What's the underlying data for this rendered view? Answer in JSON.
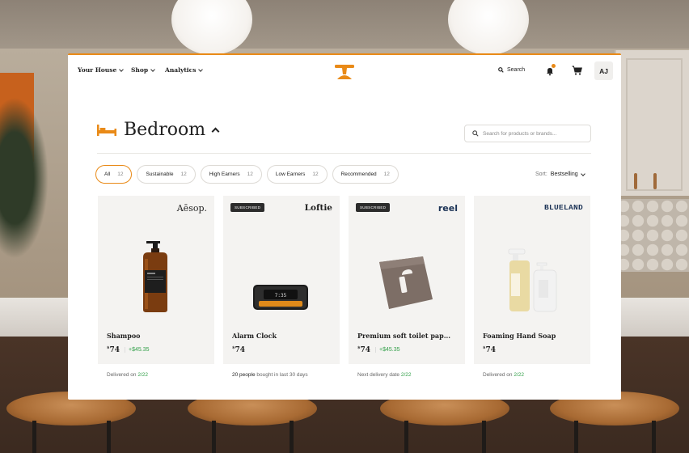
{
  "nav": {
    "items": [
      {
        "label": "Your House"
      },
      {
        "label": "Shop"
      },
      {
        "label": "Analytics"
      }
    ],
    "search_label": "Search",
    "avatar_initials": "AJ",
    "accent_color": "#e98a17"
  },
  "page": {
    "title": "Bedroom",
    "search_placeholder": "Search for products or brands..."
  },
  "filters": [
    {
      "label": "All",
      "count": "12",
      "active": true
    },
    {
      "label": "Sustainable",
      "count": "12"
    },
    {
      "label": "High Earners",
      "count": "12"
    },
    {
      "label": "Low Earners",
      "count": "12"
    },
    {
      "label": "Recommended",
      "count": "12"
    }
  ],
  "sort": {
    "label": "Sort:",
    "value": "Bestselling"
  },
  "products": [
    {
      "brand": "Aēsop.",
      "badge": "",
      "name": "Shampoo",
      "price": "74",
      "credit": "+$45.35",
      "meta_prefix": "Delivered on ",
      "meta_highlight": "2/22",
      "meta_suffix": ""
    },
    {
      "brand": "Loftie",
      "badge": "SUBSCRIBED",
      "name": "Alarm Clock",
      "price": "74",
      "credit": "",
      "meta_prefix": "",
      "meta_highlight": "20 people",
      "meta_suffix": " bought in last 30 days"
    },
    {
      "brand": "reel",
      "badge": "SUBSCRIBED",
      "name": "Premium soft toilet pap...",
      "price": "74",
      "credit": "+$45.35",
      "meta_prefix": "Next delivery date ",
      "meta_highlight": "2/22",
      "meta_suffix": ""
    },
    {
      "brand": "BLUELAND",
      "badge": "",
      "name": "Foaming Hand Soap",
      "price": "74",
      "credit": "",
      "meta_prefix": "Delivered on ",
      "meta_highlight": "2/22",
      "meta_suffix": ""
    }
  ]
}
